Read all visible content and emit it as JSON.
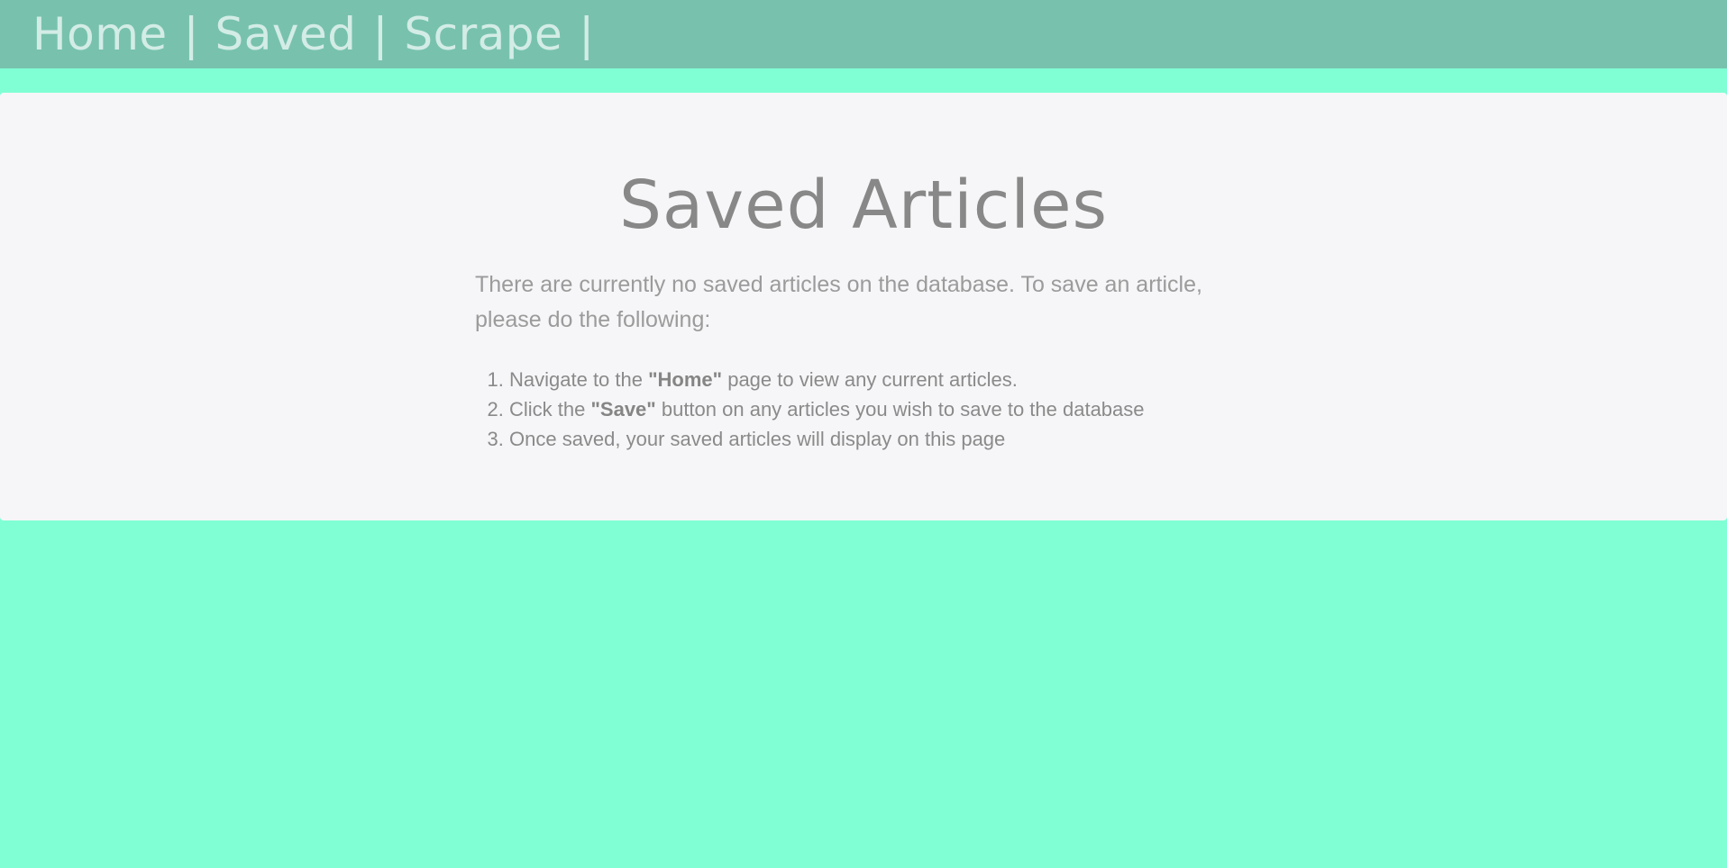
{
  "nav": {
    "links": [
      {
        "label": "Home"
      },
      {
        "label": "Saved"
      },
      {
        "label": "Scrape"
      }
    ],
    "separator": "|"
  },
  "main": {
    "title": "Saved Articles",
    "intro": "There are currently no saved articles on the database. To save an article, please do the following:",
    "steps": [
      {
        "pre": "Navigate to the ",
        "bold": "\"Home\"",
        "post": " page to view any current articles."
      },
      {
        "pre": "Click the ",
        "bold": "\"Save\"",
        "post": " button on any articles you wish to save to the database"
      },
      {
        "pre": "Once saved, your saved articles will display on this page",
        "bold": "",
        "post": ""
      }
    ]
  },
  "colors": {
    "page_background": "#80ffd4",
    "navbar_background": "#78c2ad",
    "nav_text": "#d3ece6",
    "panel_background": "#f6f6f8",
    "text": "#888888"
  }
}
